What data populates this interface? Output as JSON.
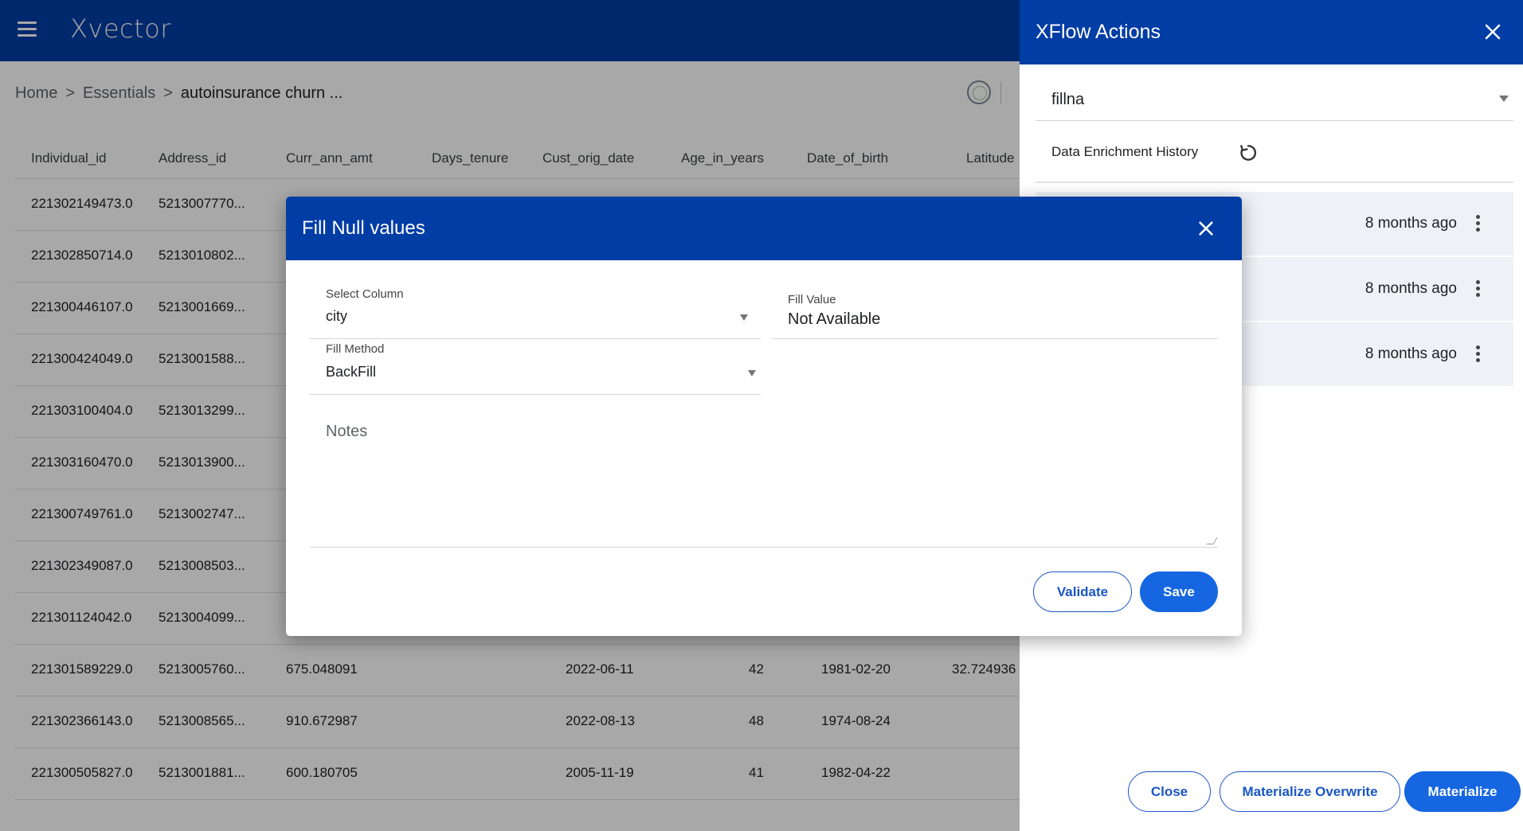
{
  "app": {
    "logo": "Xvector"
  },
  "breadcrumb": {
    "home": "Home",
    "sep": ">",
    "section": "Essentials",
    "current": "autoinsurance churn ..."
  },
  "table": {
    "columns": [
      "Individual_id",
      "Address_id",
      "Curr_ann_amt",
      "Days_tenure",
      "Cust_orig_date",
      "Age_in_years",
      "Date_of_birth",
      "Latitude"
    ],
    "rows": [
      [
        "221302149473.0",
        "5213007770...",
        "",
        "",
        "",
        "",
        "",
        ""
      ],
      [
        "221302850714.0",
        "5213010802...",
        "",
        "",
        "",
        "",
        "",
        ""
      ],
      [
        "221300446107.0",
        "5213001669...",
        "",
        "",
        "",
        "",
        "",
        ""
      ],
      [
        "221300424049.0",
        "5213001588...",
        "",
        "",
        "",
        "",
        "",
        ""
      ],
      [
        "221303100404.0",
        "5213013299...",
        "",
        "",
        "",
        "",
        "",
        ""
      ],
      [
        "221303160470.0",
        "5213013900...",
        "",
        "",
        "",
        "",
        "",
        ""
      ],
      [
        "221300749761.0",
        "5213002747...",
        "",
        "",
        "",
        "",
        "",
        ""
      ],
      [
        "221302349087.0",
        "5213008503...",
        "",
        "",
        "",
        "",
        "",
        ""
      ],
      [
        "221301124042.0",
        "5213004099...",
        "",
        "",
        "",
        "",
        "",
        ""
      ],
      [
        "221301589229.0",
        "5213005760...",
        "675.048091",
        "",
        "2022-06-11",
        "42",
        "1981-02-20",
        "32.724936"
      ],
      [
        "221302366143.0",
        "5213008565...",
        "910.672987",
        "",
        "2022-08-13",
        "48",
        "1974-08-24",
        ""
      ],
      [
        "221300505827.0",
        "5213001881...",
        "600.180705",
        "",
        "2005-11-19",
        "41",
        "1982-04-22",
        ""
      ]
    ]
  },
  "xflow": {
    "title": "XFlow Actions",
    "selected_action": "fillna",
    "history_label": "Data Enrichment History",
    "history": [
      {
        "time": "8 months ago"
      },
      {
        "time": "8 months ago"
      },
      {
        "time": "8 months ago"
      }
    ],
    "buttons": {
      "close": "Close",
      "materialize_overwrite": "Materialize Overwrite",
      "materialize": "Materialize"
    }
  },
  "modal": {
    "title": "Fill Null values",
    "select_column": {
      "label": "Select Column",
      "value": "city"
    },
    "fill_value": {
      "label": "Fill Value",
      "value": "Not Available"
    },
    "fill_method": {
      "label": "Fill Method",
      "value": "BackFill"
    },
    "notes_placeholder": "Notes",
    "buttons": {
      "validate": "Validate",
      "save": "Save"
    }
  },
  "colors": {
    "primary": "#003da5",
    "button": "#1566e0",
    "history_bg": "#eef2f7"
  },
  "icons": [
    "menu-icon",
    "globe-icon",
    "close-icon",
    "history-icon",
    "more-vert-icon",
    "chevron-down-icon"
  ]
}
